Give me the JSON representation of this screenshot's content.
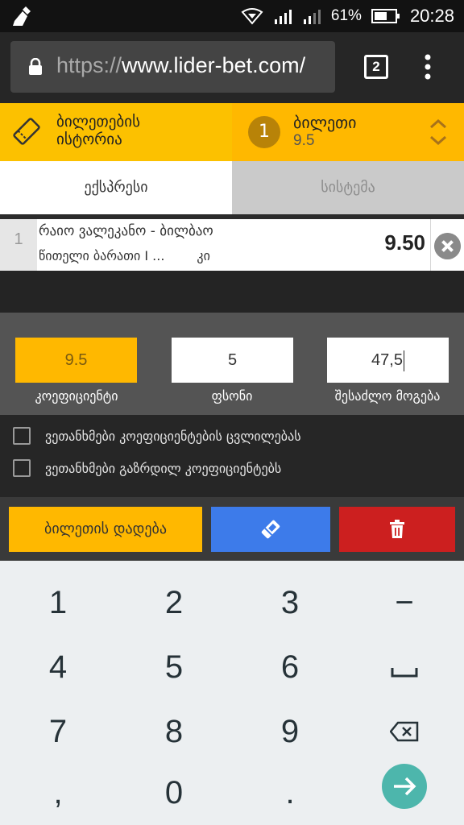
{
  "status_bar": {
    "battery": "61%",
    "time": "20:28",
    "icons": [
      "cleaner-broom-icon",
      "hotspot-icon",
      "signal-icon",
      "signal-icon",
      "battery-icon"
    ]
  },
  "browser": {
    "url_protocol": "https://",
    "url_host": "www.lider-bet.com/",
    "tab_count": "2"
  },
  "header": {
    "history_line1": "ბილეთების",
    "history_line2": "ისტორია",
    "ticket_count": "1",
    "ticket_title": "ბილეთი",
    "ticket_odds": "9.5"
  },
  "tabs": {
    "express": "ექსპრესი",
    "system": "სისტემა"
  },
  "selection": {
    "index": "1",
    "match": "რაიო ვალეკანო - ბილბაო",
    "pick": "წითელი ბარათი I ...",
    "pick_suffix": "კი",
    "odds": "9.50"
  },
  "stake": {
    "coefficient_value": "9.5",
    "stake_value": "5",
    "win_value": "47,5",
    "coefficient_label": "კოეფიციენტი",
    "stake_label": "ფსონი",
    "win_label": "შესაძლო მოგება"
  },
  "agreements": {
    "accept_odds_change": "ვეთანხმები კოეფიციენტების ცვლილებას",
    "accept_boosted_odds": "ვეთანხმები გაზრდილ კოეფიციენტებს"
  },
  "actions": {
    "place_bet": "ბილეთის დადება"
  },
  "keyboard": {
    "keys": [
      "1",
      "2",
      "3",
      "−",
      "4",
      "5",
      "6",
      "␣",
      "7",
      "8",
      "9",
      "⌫",
      ",",
      "0",
      "."
    ]
  },
  "colors": {
    "accent_yellow": "#ffb800",
    "save_blue": "#3d7bea",
    "delete_red": "#cc1f1f",
    "keyboard_go": "#4db6ac"
  }
}
